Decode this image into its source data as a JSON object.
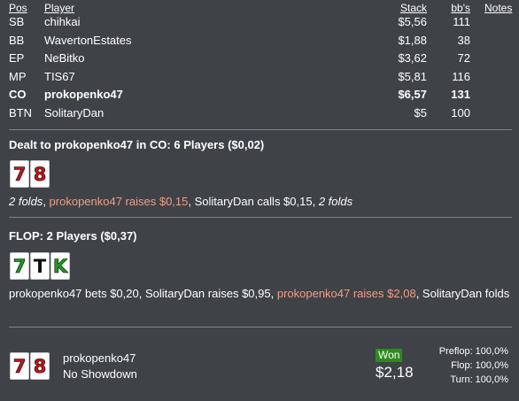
{
  "table": {
    "headers": {
      "pos": "Pos",
      "player": "Player",
      "stack": "Stack",
      "bb": "bb's",
      "notes": "Notes"
    },
    "rows": [
      {
        "pos": "SB",
        "player": "chihkai",
        "stack": "$5,56",
        "bb": "111"
      },
      {
        "pos": "BB",
        "player": "WavertonEstates",
        "stack": "$1,88",
        "bb": "38"
      },
      {
        "pos": "EP",
        "player": "NeBitko",
        "stack": "$3,62",
        "bb": "72"
      },
      {
        "pos": "MP",
        "player": "TIS67",
        "stack": "$5,81",
        "bb": "116"
      },
      {
        "pos": "CO",
        "player": "prokopenko47",
        "stack": "$6,57",
        "bb": "131"
      },
      {
        "pos": "BTN",
        "player": "SolitaryDan",
        "stack": "$5",
        "bb": "100"
      }
    ]
  },
  "preflop": {
    "title": "Dealt to prokopenko47 in CO: 6 Players ($0,02)",
    "cards": [
      {
        "rank": "7",
        "suit": "hearts"
      },
      {
        "rank": "8",
        "suit": "hearts"
      }
    ],
    "actions": {
      "a1": "2 folds",
      "sep1": ", ",
      "a2": "prokopenko47 raises $0,15",
      "sep2": ", ",
      "a3": "SolitaryDan calls $0,15",
      "sep3": ", ",
      "a4": "2 folds"
    }
  },
  "flop": {
    "title": "FLOP: 2 Players ($0,37)",
    "cards": [
      {
        "rank": "7",
        "suit": "clubs"
      },
      {
        "rank": "T",
        "suit": "spades"
      },
      {
        "rank": "K",
        "suit": "clubs"
      }
    ],
    "actions": {
      "a1": "prokopenko47 bets $0,20",
      "sep1": ", ",
      "a2": "SolitaryDan raises $0,95",
      "sep2": ", ",
      "a3": "prokopenko47 raises $2,08",
      "sep3": ", ",
      "a4": "SolitaryDan folds"
    }
  },
  "result": {
    "cards": [
      {
        "rank": "7",
        "suit": "hearts"
      },
      {
        "rank": "8",
        "suit": "hearts"
      }
    ],
    "player": "prokopenko47",
    "showdown": "No Showdown",
    "badge": "Won",
    "amount": "$2,18",
    "equity": {
      "preflop": "Preflop: 100,0%",
      "flop": "Flop: 100,0%",
      "turn": "Turn: 100,0%"
    }
  },
  "colors": {
    "background": "#3f4247",
    "hero_action": "#f09f86",
    "won_badge": "#2f8a1e",
    "hearts": "#c4161c",
    "clubs": "#1b9e1b"
  }
}
